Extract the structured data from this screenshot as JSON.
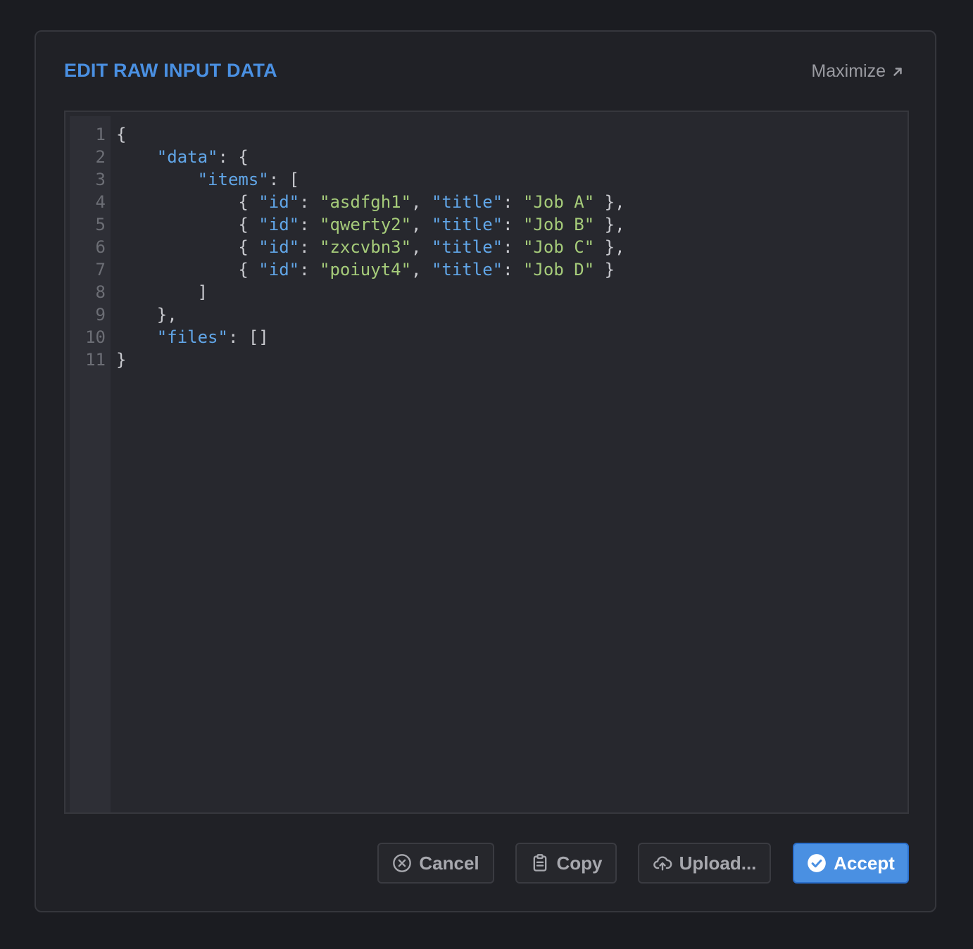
{
  "dialog": {
    "title": "EDIT RAW INPUT DATA",
    "maximize_label": "Maximize"
  },
  "editor": {
    "line_numbers": [
      "1",
      "2",
      "3",
      "4",
      "5",
      "6",
      "7",
      "8",
      "9",
      "10",
      "11"
    ],
    "lines": [
      [
        {
          "t": "punc",
          "v": "{"
        }
      ],
      [
        {
          "t": "punc",
          "v": "    "
        },
        {
          "t": "key",
          "v": "\"data\""
        },
        {
          "t": "punc",
          "v": ": {"
        }
      ],
      [
        {
          "t": "punc",
          "v": "        "
        },
        {
          "t": "key",
          "v": "\"items\""
        },
        {
          "t": "punc",
          "v": ": ["
        }
      ],
      [
        {
          "t": "punc",
          "v": "            { "
        },
        {
          "t": "key",
          "v": "\"id\""
        },
        {
          "t": "punc",
          "v": ": "
        },
        {
          "t": "str",
          "v": "\"asdfgh1\""
        },
        {
          "t": "punc",
          "v": ", "
        },
        {
          "t": "key",
          "v": "\"title\""
        },
        {
          "t": "punc",
          "v": ": "
        },
        {
          "t": "str",
          "v": "\"Job A\""
        },
        {
          "t": "punc",
          "v": " },"
        }
      ],
      [
        {
          "t": "punc",
          "v": "            { "
        },
        {
          "t": "key",
          "v": "\"id\""
        },
        {
          "t": "punc",
          "v": ": "
        },
        {
          "t": "str",
          "v": "\"qwerty2\""
        },
        {
          "t": "punc",
          "v": ", "
        },
        {
          "t": "key",
          "v": "\"title\""
        },
        {
          "t": "punc",
          "v": ": "
        },
        {
          "t": "str",
          "v": "\"Job B\""
        },
        {
          "t": "punc",
          "v": " },"
        }
      ],
      [
        {
          "t": "punc",
          "v": "            { "
        },
        {
          "t": "key",
          "v": "\"id\""
        },
        {
          "t": "punc",
          "v": ": "
        },
        {
          "t": "str",
          "v": "\"zxcvbn3\""
        },
        {
          "t": "punc",
          "v": ", "
        },
        {
          "t": "key",
          "v": "\"title\""
        },
        {
          "t": "punc",
          "v": ": "
        },
        {
          "t": "str",
          "v": "\"Job C\""
        },
        {
          "t": "punc",
          "v": " },"
        }
      ],
      [
        {
          "t": "punc",
          "v": "            { "
        },
        {
          "t": "key",
          "v": "\"id\""
        },
        {
          "t": "punc",
          "v": ": "
        },
        {
          "t": "str",
          "v": "\"poiuyt4\""
        },
        {
          "t": "punc",
          "v": ", "
        },
        {
          "t": "key",
          "v": "\"title\""
        },
        {
          "t": "punc",
          "v": ": "
        },
        {
          "t": "str",
          "v": "\"Job D\""
        },
        {
          "t": "punc",
          "v": " }"
        }
      ],
      [
        {
          "t": "punc",
          "v": "        ]"
        }
      ],
      [
        {
          "t": "punc",
          "v": "    },"
        }
      ],
      [
        {
          "t": "punc",
          "v": "    "
        },
        {
          "t": "key",
          "v": "\"files\""
        },
        {
          "t": "punc",
          "v": ": []"
        }
      ],
      [
        {
          "t": "punc",
          "v": "}"
        }
      ]
    ]
  },
  "buttons": {
    "cancel": {
      "label": "Cancel",
      "icon": "x-circle-icon"
    },
    "copy": {
      "label": "Copy",
      "icon": "clipboard-icon"
    },
    "upload": {
      "label": "Upload...",
      "icon": "cloud-upload-icon"
    },
    "accept": {
      "label": "Accept",
      "icon": "check-circle-icon"
    }
  },
  "colors": {
    "accent": "#4a90e2",
    "json_key": "#61a6e8",
    "json_string": "#a6cc7a",
    "background": "#1b1c21"
  }
}
